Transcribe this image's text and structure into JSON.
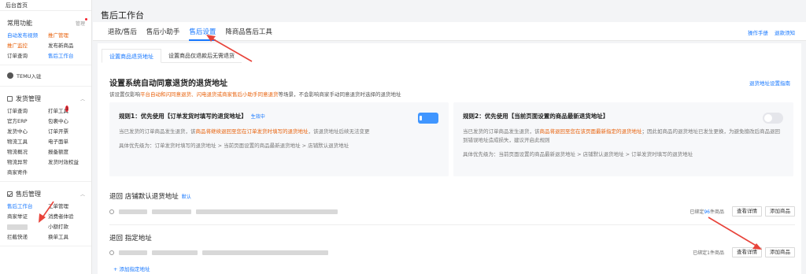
{
  "sidebar": {
    "home": "后台首页",
    "common": {
      "title": "常用功能",
      "manage": "管理",
      "items": [
        "自动发布视频",
        "推广管理",
        "推广监控",
        "发布新商品",
        "订单查询",
        "售后工作台"
      ]
    },
    "temu": "TEMU入驻",
    "shipping": {
      "title": "发货管理",
      "items": [
        "订单查询",
        "打单工具",
        "官方ERP",
        "包裹中心",
        "发货中心",
        "订单开票",
        "物流工具",
        "电子面单",
        "物流概况",
        "报备额度",
        "物流异常",
        "发货时效权益",
        "商家寄件"
      ],
      "badge": "1"
    },
    "aftersale": {
      "title": "售后管理",
      "items": [
        "售后工作台",
        "工单管理",
        "商家举证",
        "消费者体验",
        "",
        "小额打款",
        "拦截快递",
        "换单工具"
      ]
    }
  },
  "main": {
    "title": "售后工作台",
    "tabs": [
      "退款/售后",
      "售后小助手",
      "售后设置",
      "降商品售后工具"
    ],
    "active_tab": 2,
    "links": [
      "操作手册",
      "退款须知"
    ],
    "subtabs": [
      "设置商品退货地址",
      "设置商品仅退款后无需退货"
    ],
    "section_title": "设置系统自动同意退货的退货地址",
    "guide_link": "退货地址设置指南",
    "desc": {
      "pre": "该设置仅影响",
      "hl": "平台自动和闪同意退货、闪电退货或商家售后小助手同意退货",
      "post": "等场景，不会影响商家手动同意退货时选择的退货地址"
    },
    "rule1": {
      "title": "规则1：优先使用【订单发货时填写的退货地址】",
      "status": "生效中",
      "text_pre": "当已发货的订单商品发生退货，该",
      "text_hl": "商品将继续退回至您在订单发货时填写的退货地址",
      "text_post": "，该退货地址后续无法变更",
      "priority": "具体优先级为：订单发货时填写的退货地址 > 当前页面设置的商品最新退货地址 > 店铺默认退货地址",
      "enabled": true
    },
    "rule2": {
      "title": "规则2：优先使用【当前页面设置的商品最新退货地址】",
      "text_pre": "当已发货的订单商品发生退货，该",
      "text_hl": "商品将退回至您在该页面最新指定的退货地址",
      "text_post": "；因此如商品的退货地址已发生更换，为避免擅改后商品退回到错误地址造成损失，建议开启此规则",
      "priority": "具体优先级为：当前页面设置的商品最新退货地址 > 店铺默认退货地址 > 订单发货时填写的退货地址",
      "enabled": false
    },
    "default_addr": {
      "title": "退回 店铺默认退货地址",
      "tag": "默认",
      "bound_pre": "已绑定",
      "bound_num": "96",
      "bound_post": "件商品",
      "btn_view": "查看详情",
      "btn_add": "添加商品"
    },
    "specified_addr": {
      "title": "退回 指定地址",
      "bound": "已绑定1件商品",
      "btn_view": "查看详情",
      "btn_add": "添加商品"
    },
    "add_address": "+ 添加指定地址"
  },
  "colors": {
    "accent": "#1677ff",
    "highlight": "#e8620c",
    "annotation": "#e8433a"
  }
}
